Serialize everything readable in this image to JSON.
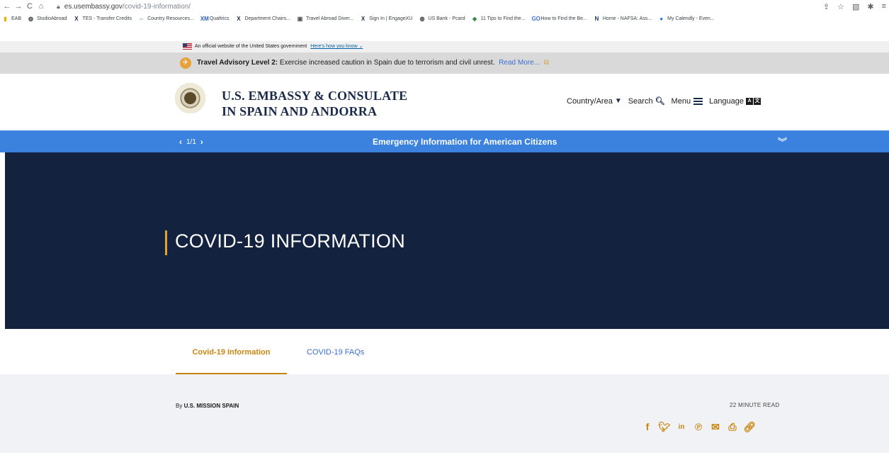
{
  "browser": {
    "url_host": "es.usembassy.gov",
    "url_path": "/covid-19-information/",
    "bookmarks": [
      {
        "label": "EAB",
        "icon": "eab-icon",
        "glyph": "▮",
        "color": "#e8b00a"
      },
      {
        "label": "StudioAbroad",
        "icon": "globe-icon",
        "glyph": "◍",
        "color": "#444444"
      },
      {
        "label": "TES - Transfer Credits",
        "icon": "x-logo-icon",
        "glyph": "X",
        "color": "#1a2a4a"
      },
      {
        "label": "Country Resources...",
        "icon": "link-icon",
        "glyph": "⇔",
        "color": "#4a7ad4"
      },
      {
        "label": "Qualtrics",
        "icon": "qualtrics-icon",
        "glyph": "XM",
        "color": "#2a5fb8"
      },
      {
        "label": "Department Chairs...",
        "icon": "x-logo-icon",
        "glyph": "X",
        "color": "#1a2a4a"
      },
      {
        "label": "Travel Abroad Diver...",
        "icon": "site-icon",
        "glyph": "▣",
        "color": "#555555"
      },
      {
        "label": "Sign In | EngageXU",
        "icon": "x-logo-icon",
        "glyph": "X",
        "color": "#1a2a4a"
      },
      {
        "label": "US Bank - Pcard",
        "icon": "globe-icon",
        "glyph": "◍",
        "color": "#444444"
      },
      {
        "label": "11 Tips to Find the...",
        "icon": "site-icon",
        "glyph": "◆",
        "color": "#2f8f4a"
      },
      {
        "label": "How to Find the Be...",
        "icon": "site-icon",
        "glyph": "GO",
        "color": "#3b6fd1"
      },
      {
        "label": "Home - NAFSA: Ass...",
        "icon": "nafsa-icon",
        "glyph": "N",
        "color": "#1a3a6a"
      },
      {
        "label": "My Calendly - Even...",
        "icon": "calendly-icon",
        "glyph": "●",
        "color": "#1a73e8"
      }
    ]
  },
  "official_banner": {
    "text": "An official website of the United States government",
    "link": "Here's how you know"
  },
  "advisory": {
    "level": "Travel Advisory Level 2:",
    "text": "Exercise increased caution in Spain due to terrorism and civil unrest.",
    "link": "Read More..."
  },
  "header": {
    "title_line1": "U.S. EMBASSY & CONSULATE",
    "title_line2": "IN SPAIN AND ANDORRA",
    "nav": {
      "country": "Country/Area",
      "search": "Search",
      "menu": "Menu",
      "language": "Language"
    }
  },
  "emergency": {
    "pager": "1/1",
    "title": "Emergency Information for American Citizens"
  },
  "hero": {
    "title": "COVID-19 INFORMATION"
  },
  "tabs": [
    {
      "label": "Covid-19 Information"
    },
    {
      "label": "COVID-19 FAQs"
    }
  ],
  "article": {
    "by_prefix": "By",
    "author": "U.S. MISSION SPAIN",
    "read_time": "22 MINUTE READ"
  },
  "colors": {
    "accent_gold": "#c8860e",
    "hero_navy": "#13223f",
    "emergency_blue": "#3b82de"
  }
}
